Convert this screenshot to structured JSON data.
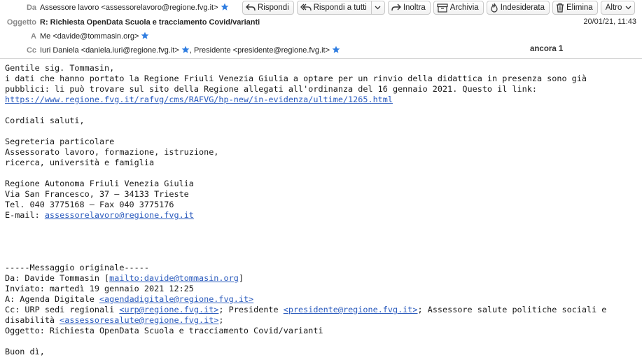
{
  "header": {
    "from_label": "Da",
    "from_value": "Assessore lavoro <assessorelavoro@regione.fvg.it>",
    "subject_label": "Oggetto",
    "subject_value": "R: Richiesta OpenData Scuola e tracciamento Covid/varianti",
    "date": "20/01/21, 11:43",
    "to_label": "A",
    "to_value": "Me <davide@tommasin.org>",
    "cc_label": "Cc",
    "cc_value_1": "Iuri Daniela <daniela.iuri@regione.fvg.it>",
    "cc_value_2": ", Presidente <presidente@regione.fvg.it>",
    "ancora": "ancora 1"
  },
  "toolbar": {
    "reply": "Rispondi",
    "reply_all": "Rispondi a tutti",
    "forward": "Inoltra",
    "archive": "Archivia",
    "junk": "Indesiderata",
    "delete": "Elimina",
    "more": "Altro"
  },
  "body": {
    "l1": "Gentile sig. Tommasin,",
    "l2": "i dati che hanno portato la Regione Friuli Venezia Giulia a optare per un rinvio della didattica in presenza sono già",
    "l3": "pubblici: li può trovare sul sito della Regione allegati all'ordinanza del 16 gennaio 2021. Questo il link:",
    "link1": "https://www.regione.fvg.it/rafvg/cms/RAFVG/hp-new/in-evidenza/ultime/1265.html",
    "l5": "Cordiali saluti,",
    "sig1": "Segreteria particolare",
    "sig2": "Assessorato lavoro, formazione, istruzione,",
    "sig3": "ricerca, università e famiglia",
    "sig4": "Regione Autonoma Friuli Venezia Giulia",
    "sig5": "Via San Francesco, 37 – 34133 Trieste",
    "sig6": "Tel. 040 3775168 – Fax 040 3775176",
    "email_label": "E-mail: ",
    "email_link": "assessorelavoro@regione.fvg.it",
    "orig_sep": "-----Messaggio originale-----",
    "orig_from_a": "Da: Davide Tommasin [",
    "orig_from_link": "mailto:davide@tommasin.org",
    "orig_from_b": "]",
    "orig_sent": "Inviato: martedì 19 gennaio 2021 12:25",
    "orig_to_a": "A: Agenda Digitale ",
    "orig_to_link": "<agendadigitale@regione.fvg.it>",
    "orig_cc_a": "Cc: URP sedi regionali ",
    "orig_cc_link1": "<urp@regione.fvg.it>",
    "orig_cc_b": "; Presidente ",
    "orig_cc_link2": "<presidente@regione.fvg.it>",
    "orig_cc_c": "; Assessore salute politiche sociali e",
    "orig_cc2_a": "disabilità ",
    "orig_cc2_link": "<assessoresalute@regione.fvg.it>",
    "orig_cc2_b": ";",
    "orig_subject": "Oggetto: Richiesta OpenData Scuola e tracciamento Covid/varianti",
    "greeting": "Buon dì,"
  },
  "colors": {
    "star": "#2f7de1",
    "link": "#2b5bbd",
    "label": "#8a8a8a"
  }
}
